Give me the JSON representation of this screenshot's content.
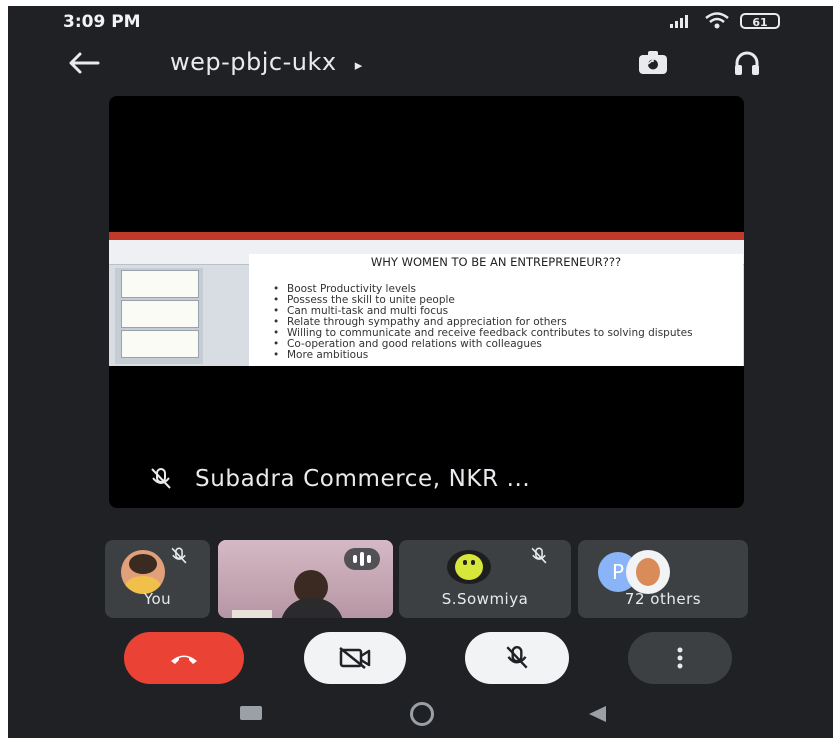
{
  "status_bar": {
    "time": "3:09 PM",
    "battery": "61"
  },
  "header": {
    "meeting_code": "wep-pbjc-ukx",
    "arrow": "▸"
  },
  "presentation": {
    "presenter_name": "Subadra Commerce, NKR ...",
    "slide_title": "WHY WOMEN TO BE AN ENTREPRENEUR???",
    "slide_bullets": [
      "Boost Productivity levels",
      "Possess the skill to unite people",
      "Can multi-task and multi focus",
      "Relate through sympathy and appreciation for others",
      "Willing to communicate and receive feedback contributes to solving disputes",
      "Co-operation and good relations with colleagues",
      "More ambitious"
    ]
  },
  "participants": [
    {
      "label": "You",
      "muted": true
    },
    {
      "label": "",
      "speaking": true
    },
    {
      "label": "S.Sowmiya",
      "muted": true
    },
    {
      "label": "72 others",
      "initial": "P"
    }
  ],
  "colors": {
    "background": "#202124",
    "tile": "#3c4043",
    "end_call": "#ea4335",
    "control": "#f1f3f4",
    "more": "#3c4043"
  },
  "icons": [
    "back-arrow-icon",
    "switch-camera-icon",
    "headphones-icon",
    "mic-off-icon",
    "audio-level-icon",
    "end-call-icon",
    "video-off-icon",
    "more-options-icon",
    "nav-recents-icon",
    "nav-home-icon",
    "nav-back-icon"
  ]
}
